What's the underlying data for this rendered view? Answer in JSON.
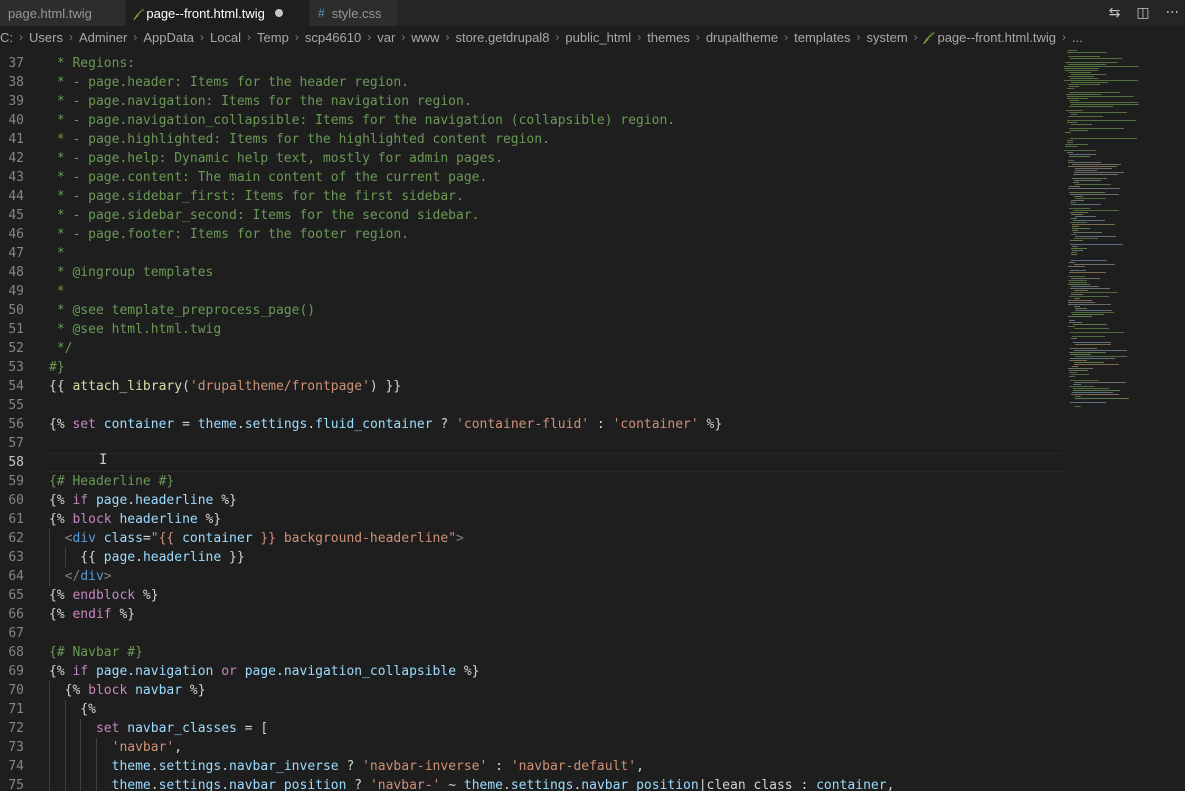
{
  "tabs": [
    {
      "label": "page.html.twig",
      "icon": "twig-file-icon",
      "active": false,
      "dirty": false
    },
    {
      "label": "page--front.html.twig",
      "icon": "twig-file-icon",
      "active": true,
      "dirty": true
    },
    {
      "label": "style.css",
      "icon": "css-file-icon",
      "active": false,
      "dirty": false
    }
  ],
  "tab_icons": {
    "twig": "𝒻",
    "css": "#"
  },
  "actions": {
    "compare": "⇆",
    "split": "◫",
    "more": "···"
  },
  "breadcrumb": [
    "C:",
    "Users",
    "Adminer",
    "AppData",
    "Local",
    "Temp",
    "scp46610",
    "var",
    "www",
    "store.getdrupal8",
    "public_html",
    "themes",
    "drupaltheme",
    "templates",
    "system",
    "page--front.html.twig",
    "..."
  ],
  "breadcrumb_sep": "›",
  "lines": [
    {
      "n": "37",
      "tokens": [
        {
          "t": " * Regions:",
          "c": "tk-comment"
        }
      ]
    },
    {
      "n": "38",
      "tokens": [
        {
          "t": " * - page.header: Items for the header region.",
          "c": "tk-comment"
        }
      ]
    },
    {
      "n": "39",
      "tokens": [
        {
          "t": " * - page.navigation: Items for the navigation region.",
          "c": "tk-comment"
        }
      ]
    },
    {
      "n": "40",
      "tokens": [
        {
          "t": " * - page.navigation_collapsible: Items for the navigation (collapsible) region.",
          "c": "tk-comment"
        }
      ]
    },
    {
      "n": "41",
      "tokens": [
        {
          "t": " * - page.highlighted: Items for the highlighted content region.",
          "c": "tk-comment"
        }
      ]
    },
    {
      "n": "42",
      "tokens": [
        {
          "t": " * - page.help: Dynamic help text, mostly for admin pages.",
          "c": "tk-comment"
        }
      ]
    },
    {
      "n": "43",
      "tokens": [
        {
          "t": " * - page.content: The main content of the current page.",
          "c": "tk-comment"
        }
      ]
    },
    {
      "n": "44",
      "tokens": [
        {
          "t": " * - page.sidebar_first: Items for the first sidebar.",
          "c": "tk-comment"
        }
      ]
    },
    {
      "n": "45",
      "tokens": [
        {
          "t": " * - page.sidebar_second: Items for the second sidebar.",
          "c": "tk-comment"
        }
      ]
    },
    {
      "n": "46",
      "tokens": [
        {
          "t": " * - page.footer: Items for the footer region.",
          "c": "tk-comment"
        }
      ]
    },
    {
      "n": "47",
      "tokens": [
        {
          "t": " *",
          "c": "tk-comment"
        }
      ]
    },
    {
      "n": "48",
      "tokens": [
        {
          "t": " * @ingroup templates",
          "c": "tk-comment"
        }
      ]
    },
    {
      "n": "49",
      "tokens": [
        {
          "t": " *",
          "c": "tk-comment"
        }
      ]
    },
    {
      "n": "50",
      "tokens": [
        {
          "t": " * @see template_preprocess_page()",
          "c": "tk-comment"
        }
      ]
    },
    {
      "n": "51",
      "tokens": [
        {
          "t": " * @see html.html.twig",
          "c": "tk-comment"
        }
      ]
    },
    {
      "n": "52",
      "tokens": [
        {
          "t": " */",
          "c": "tk-comment"
        }
      ]
    },
    {
      "n": "53",
      "tokens": [
        {
          "t": "#}",
          "c": "tk-comment"
        }
      ]
    },
    {
      "n": "54",
      "tokens": [
        {
          "t": "{{ ",
          "c": "tk-delim"
        },
        {
          "t": "attach_library",
          "c": "tk-fn"
        },
        {
          "t": "(",
          "c": "tk-plain"
        },
        {
          "t": "'drupaltheme/frontpage'",
          "c": "tk-str"
        },
        {
          "t": ") }}",
          "c": "tk-plain"
        }
      ]
    },
    {
      "n": "55",
      "tokens": []
    },
    {
      "n": "56",
      "tokens": [
        {
          "t": "{% ",
          "c": "tk-delim"
        },
        {
          "t": "set",
          "c": "tk-kw"
        },
        {
          "t": " container",
          "c": "tk-var"
        },
        {
          "t": " = ",
          "c": "tk-plain"
        },
        {
          "t": "theme",
          "c": "tk-var"
        },
        {
          "t": ".",
          "c": "tk-plain"
        },
        {
          "t": "settings",
          "c": "tk-var"
        },
        {
          "t": ".",
          "c": "tk-plain"
        },
        {
          "t": "fluid_container",
          "c": "tk-var"
        },
        {
          "t": " ? ",
          "c": "tk-plain"
        },
        {
          "t": "'container-fluid'",
          "c": "tk-str"
        },
        {
          "t": " : ",
          "c": "tk-plain"
        },
        {
          "t": "'container'",
          "c": "tk-str"
        },
        {
          "t": " %}",
          "c": "tk-delim"
        }
      ]
    },
    {
      "n": "57",
      "tokens": []
    },
    {
      "n": "58",
      "tokens": [],
      "current": true
    },
    {
      "n": "59",
      "tokens": [
        {
          "t": "{# Headerline #}",
          "c": "tk-comment"
        }
      ]
    },
    {
      "n": "60",
      "tokens": [
        {
          "t": "{% ",
          "c": "tk-delim"
        },
        {
          "t": "if",
          "c": "tk-kw"
        },
        {
          "t": " page",
          "c": "tk-var"
        },
        {
          "t": ".",
          "c": "tk-plain"
        },
        {
          "t": "headerline",
          "c": "tk-var"
        },
        {
          "t": " %}",
          "c": "tk-delim"
        }
      ]
    },
    {
      "n": "61",
      "tokens": [
        {
          "t": "{% ",
          "c": "tk-delim"
        },
        {
          "t": "block",
          "c": "tk-kw"
        },
        {
          "t": " headerline",
          "c": "tk-var"
        },
        {
          "t": " %}",
          "c": "tk-delim"
        }
      ]
    },
    {
      "n": "62",
      "indent": 1,
      "tokens": [
        {
          "t": "  ",
          "c": "tk-plain"
        },
        {
          "t": "<",
          "c": "tk-punct"
        },
        {
          "t": "div",
          "c": "tk-tag"
        },
        {
          "t": " class",
          "c": "tk-var"
        },
        {
          "t": "=",
          "c": "tk-plain"
        },
        {
          "t": "\"{{ ",
          "c": "tk-str"
        },
        {
          "t": "container",
          "c": "tk-var"
        },
        {
          "t": " }} background-headerline\"",
          "c": "tk-str"
        },
        {
          "t": ">",
          "c": "tk-punct"
        }
      ]
    },
    {
      "n": "63",
      "indent": 2,
      "tokens": [
        {
          "t": "    {{ ",
          "c": "tk-delim"
        },
        {
          "t": "page",
          "c": "tk-var"
        },
        {
          "t": ".",
          "c": "tk-plain"
        },
        {
          "t": "headerline",
          "c": "tk-var"
        },
        {
          "t": " }}",
          "c": "tk-delim"
        }
      ]
    },
    {
      "n": "64",
      "indent": 1,
      "tokens": [
        {
          "t": "  ",
          "c": "tk-plain"
        },
        {
          "t": "</",
          "c": "tk-punct"
        },
        {
          "t": "div",
          "c": "tk-tag"
        },
        {
          "t": ">",
          "c": "tk-punct"
        }
      ]
    },
    {
      "n": "65",
      "tokens": [
        {
          "t": "{% ",
          "c": "tk-delim"
        },
        {
          "t": "endblock",
          "c": "tk-kw"
        },
        {
          "t": " %}",
          "c": "tk-delim"
        }
      ]
    },
    {
      "n": "66",
      "tokens": [
        {
          "t": "{% ",
          "c": "tk-delim"
        },
        {
          "t": "endif",
          "c": "tk-kw"
        },
        {
          "t": " %}",
          "c": "tk-delim"
        }
      ]
    },
    {
      "n": "67",
      "tokens": []
    },
    {
      "n": "68",
      "tokens": [
        {
          "t": "{# Navbar #}",
          "c": "tk-comment"
        }
      ]
    },
    {
      "n": "69",
      "tokens": [
        {
          "t": "{% ",
          "c": "tk-delim"
        },
        {
          "t": "if",
          "c": "tk-kw"
        },
        {
          "t": " page",
          "c": "tk-var"
        },
        {
          "t": ".",
          "c": "tk-plain"
        },
        {
          "t": "navigation",
          "c": "tk-var"
        },
        {
          "t": " or ",
          "c": "tk-kw"
        },
        {
          "t": "page",
          "c": "tk-var"
        },
        {
          "t": ".",
          "c": "tk-plain"
        },
        {
          "t": "navigation_collapsible",
          "c": "tk-var"
        },
        {
          "t": " %}",
          "c": "tk-delim"
        }
      ]
    },
    {
      "n": "70",
      "indent": 1,
      "tokens": [
        {
          "t": "  {% ",
          "c": "tk-delim"
        },
        {
          "t": "block",
          "c": "tk-kw"
        },
        {
          "t": " navbar",
          "c": "tk-var"
        },
        {
          "t": " %}",
          "c": "tk-delim"
        }
      ]
    },
    {
      "n": "71",
      "indent": 2,
      "tokens": [
        {
          "t": "    {%",
          "c": "tk-delim"
        }
      ]
    },
    {
      "n": "72",
      "indent": 3,
      "tokens": [
        {
          "t": "      ",
          "c": "tk-plain"
        },
        {
          "t": "set",
          "c": "tk-kw"
        },
        {
          "t": " navbar_classes",
          "c": "tk-var"
        },
        {
          "t": " = [",
          "c": "tk-plain"
        }
      ]
    },
    {
      "n": "73",
      "indent": 4,
      "tokens": [
        {
          "t": "        ",
          "c": "tk-plain"
        },
        {
          "t": "'navbar'",
          "c": "tk-str"
        },
        {
          "t": ",",
          "c": "tk-plain"
        }
      ]
    },
    {
      "n": "74",
      "indent": 4,
      "tokens": [
        {
          "t": "        ",
          "c": "tk-plain"
        },
        {
          "t": "theme",
          "c": "tk-var"
        },
        {
          "t": ".",
          "c": "tk-plain"
        },
        {
          "t": "settings",
          "c": "tk-var"
        },
        {
          "t": ".",
          "c": "tk-plain"
        },
        {
          "t": "navbar_inverse",
          "c": "tk-var"
        },
        {
          "t": " ? ",
          "c": "tk-plain"
        },
        {
          "t": "'navbar-inverse'",
          "c": "tk-str"
        },
        {
          "t": " : ",
          "c": "tk-plain"
        },
        {
          "t": "'navbar-default'",
          "c": "tk-str"
        },
        {
          "t": ",",
          "c": "tk-plain"
        }
      ]
    },
    {
      "n": "75",
      "indent": 4,
      "tokens": [
        {
          "t": "        ",
          "c": "tk-plain"
        },
        {
          "t": "theme",
          "c": "tk-var"
        },
        {
          "t": ".",
          "c": "tk-plain"
        },
        {
          "t": "settings",
          "c": "tk-var"
        },
        {
          "t": ".",
          "c": "tk-plain"
        },
        {
          "t": "navbar_position",
          "c": "tk-var"
        },
        {
          "t": " ? ",
          "c": "tk-plain"
        },
        {
          "t": "'navbar-'",
          "c": "tk-str"
        },
        {
          "t": " ~ ",
          "c": "tk-plain"
        },
        {
          "t": "theme",
          "c": "tk-var"
        },
        {
          "t": ".",
          "c": "tk-plain"
        },
        {
          "t": "settings",
          "c": "tk-var"
        },
        {
          "t": ".",
          "c": "tk-plain"
        },
        {
          "t": "navbar_position",
          "c": "tk-var"
        },
        {
          "t": "|clean_class : ",
          "c": "tk-plain"
        },
        {
          "t": "container",
          "c": "tk-var"
        },
        {
          "t": ",",
          "c": "tk-plain"
        }
      ]
    }
  ],
  "cursor_glyph": "I",
  "colors": {
    "comment": "#6a9955",
    "keyword": "#c586c0",
    "string": "#ce9178",
    "variable": "#9cdcfe",
    "function": "#dcdcaa",
    "tag": "#569cd6",
    "background": "#1e1e1e"
  }
}
